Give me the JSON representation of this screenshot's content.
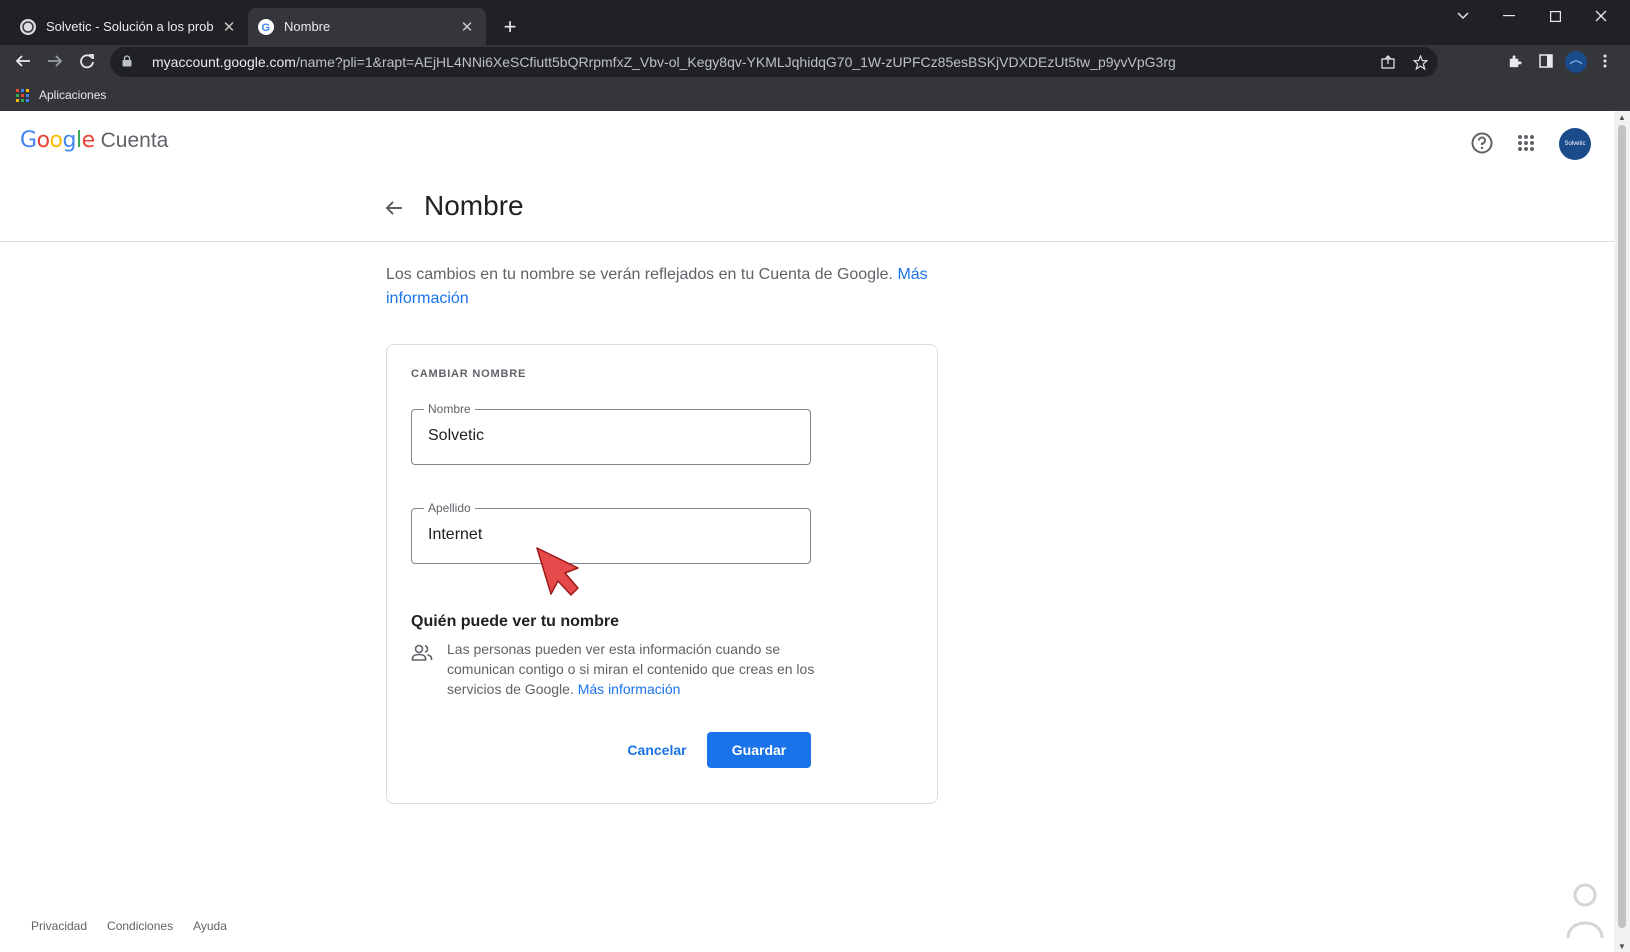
{
  "browser": {
    "tabs": [
      {
        "title": "Solvetic - Solución a los problem",
        "active": false
      },
      {
        "title": "Nombre",
        "active": true
      }
    ],
    "new_tab": "+",
    "url_host": "myaccount.google.com",
    "url_path": "/name?pli=1&rapt=AEjHL4NNi6XeSCfiutt5bQRrpmfxZ_Vbv-ol_Kegy8qv-YKMLJqhidqG70_1W-zUPFCz85esBSKjVDXDEzUt5tw_p9yvVpG3rg",
    "bookmark": "Aplicaciones"
  },
  "header": {
    "logo_letters": [
      "G",
      "o",
      "o",
      "g",
      "l",
      "e"
    ],
    "product": "Cuenta",
    "avatar_text": "Solvetic"
  },
  "page": {
    "title": "Nombre",
    "description": "Los cambios en tu nombre se verán reflejados en tu Cuenta de Google.",
    "description_link": "Más información"
  },
  "card": {
    "heading": "CAMBIAR NOMBRE",
    "first_name_label": "Nombre",
    "first_name_value": "Solvetic",
    "last_name_label": "Apellido",
    "last_name_value": "Internet",
    "who_title": "Quién puede ver tu nombre",
    "who_desc": "Las personas pueden ver esta información cuando se comunican contigo o si miran el contenido que creas en los servicios de Google.",
    "who_link": "Más información",
    "cancel": "Cancelar",
    "save": "Guardar"
  },
  "footer": {
    "links": [
      "Privacidad",
      "Condiciones",
      "Ayuda"
    ]
  },
  "colors": {
    "accent": "#1a73e8",
    "chrome_dark": "#202124",
    "chrome_toolbar": "#35363a"
  }
}
